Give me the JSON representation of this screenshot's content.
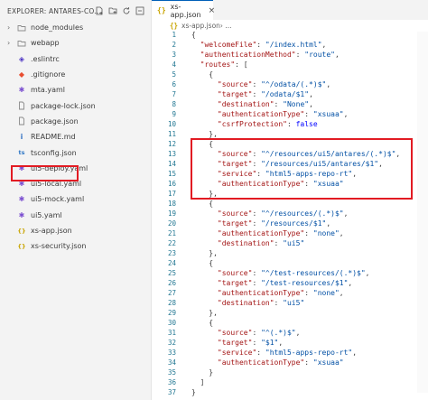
{
  "explorer": {
    "title": "EXPLORER: ANTARES-CO...",
    "actions": [
      "new-file-icon",
      "new-folder-icon",
      "refresh-icon",
      "collapse-all-icon"
    ],
    "items": [
      {
        "label": "node_modules",
        "twisty": "›",
        "icon": "folder-icon",
        "glyph": "",
        "color": "#8c8c8c"
      },
      {
        "label": "webapp",
        "twisty": "›",
        "icon": "folder-icon",
        "glyph": "",
        "color": "#8c8c8c"
      },
      {
        "label": ".eslintrc",
        "twisty": "",
        "icon": "eslint-icon",
        "glyph": "◈",
        "color": "#4b32c3"
      },
      {
        "label": ".gitignore",
        "twisty": "",
        "icon": "git-icon",
        "glyph": "◆",
        "color": "#e84e31"
      },
      {
        "label": "mta.yaml",
        "twisty": "",
        "icon": "mta-icon",
        "glyph": "✱",
        "color": "#7b4fd0"
      },
      {
        "label": "package-lock.json",
        "twisty": "",
        "icon": "json-file-icon",
        "glyph": "",
        "color": "#8a8a8a"
      },
      {
        "label": "package.json",
        "twisty": "",
        "icon": "json-file-icon",
        "glyph": "",
        "color": "#8a8a8a"
      },
      {
        "label": "README.md",
        "twisty": "",
        "icon": "markdown-icon",
        "glyph": "i",
        "color": "#3b77c4"
      },
      {
        "label": "tsconfig.json",
        "twisty": "",
        "icon": "tsconfig-icon",
        "glyph": "ts",
        "color": "#3178c6"
      },
      {
        "label": "ui5-deploy.yaml",
        "twisty": "",
        "icon": "ui5-icon",
        "glyph": "✱",
        "color": "#7b4fd0"
      },
      {
        "label": "ui5-local.yaml",
        "twisty": "",
        "icon": "ui5-icon",
        "glyph": "✱",
        "color": "#7b4fd0"
      },
      {
        "label": "ui5-mock.yaml",
        "twisty": "",
        "icon": "ui5-icon",
        "glyph": "✱",
        "color": "#7b4fd0"
      },
      {
        "label": "ui5.yaml",
        "twisty": "",
        "icon": "ui5-icon",
        "glyph": "✱",
        "color": "#7b4fd0"
      },
      {
        "label": "xs-app.json",
        "twisty": "",
        "icon": "json-braces-icon",
        "glyph": "{}",
        "color": "#c8a400"
      },
      {
        "label": "xs-security.json",
        "twisty": "",
        "icon": "json-braces-icon",
        "glyph": "{}",
        "color": "#c8a400"
      }
    ]
  },
  "editor": {
    "tab": {
      "label": "xs-app.json",
      "icon": "json-braces-icon",
      "glyph": "{}",
      "close": "×"
    },
    "breadcrumb": {
      "label": "xs-app.json",
      "suffix": " › ...",
      "glyph": "{}"
    },
    "lines": [
      {
        "n": "1",
        "t": "{"
      },
      {
        "n": "2",
        "t": "  \"welcomeFile\": \"/index.html\","
      },
      {
        "n": "3",
        "t": "  \"authenticationMethod\": \"route\","
      },
      {
        "n": "4",
        "t": "  \"routes\": ["
      },
      {
        "n": "5",
        "t": "    {"
      },
      {
        "n": "6",
        "t": "      \"source\": \"^/odata/(.*)$\","
      },
      {
        "n": "7",
        "t": "      \"target\": \"/odata/$1\","
      },
      {
        "n": "8",
        "t": "      \"destination\": \"None\","
      },
      {
        "n": "9",
        "t": "      \"authenticationType\": \"xsuaa\","
      },
      {
        "n": "10",
        "t": "      \"csrfProtection\": false"
      },
      {
        "n": "11",
        "t": "    },"
      },
      {
        "n": "12",
        "t": "    {"
      },
      {
        "n": "13",
        "t": "      \"source\": \"^/resources/ui5/antares/(.*)$\","
      },
      {
        "n": "14",
        "t": "      \"target\": \"/resources/ui5/antares/$1\","
      },
      {
        "n": "15",
        "t": "      \"service\": \"html5-apps-repo-rt\","
      },
      {
        "n": "16",
        "t": "      \"authenticationType\": \"xsuaa\""
      },
      {
        "n": "17",
        "t": "    },"
      },
      {
        "n": "18",
        "t": "    {"
      },
      {
        "n": "19",
        "t": "      \"source\": \"^/resources/(.*)$\","
      },
      {
        "n": "20",
        "t": "      \"target\": \"/resources/$1\","
      },
      {
        "n": "21",
        "t": "      \"authenticationType\": \"none\","
      },
      {
        "n": "22",
        "t": "      \"destination\": \"ui5\""
      },
      {
        "n": "23",
        "t": "    },"
      },
      {
        "n": "24",
        "t": "    {"
      },
      {
        "n": "25",
        "t": "      \"source\": \"^/test-resources/(.*)$\","
      },
      {
        "n": "26",
        "t": "      \"target\": \"/test-resources/$1\","
      },
      {
        "n": "27",
        "t": "      \"authenticationType\": \"none\","
      },
      {
        "n": "28",
        "t": "      \"destination\": \"ui5\""
      },
      {
        "n": "29",
        "t": "    },"
      },
      {
        "n": "30",
        "t": "    {"
      },
      {
        "n": "31",
        "t": "      \"source\": \"^(.*)$\","
      },
      {
        "n": "32",
        "t": "      \"target\": \"$1\","
      },
      {
        "n": "33",
        "t": "      \"service\": \"html5-apps-repo-rt\","
      },
      {
        "n": "34",
        "t": "      \"authenticationType\": \"xsuaa\""
      },
      {
        "n": "35",
        "t": "    }"
      },
      {
        "n": "36",
        "t": "  ]"
      },
      {
        "n": "37",
        "t": "}"
      }
    ]
  },
  "colors": {
    "highlight": "#e21b23",
    "key": "#a31515",
    "string": "#0451a5",
    "lineNumber": "#237893",
    "boolean": "#0000ff"
  }
}
